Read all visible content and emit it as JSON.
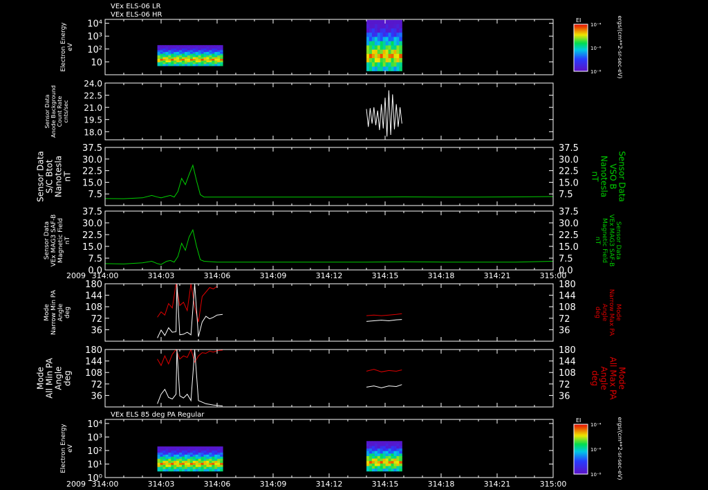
{
  "header": {
    "title1": "VEx ELS-06 LR",
    "title2": "VEx ELS-06 HR",
    "title3": "VEx ELS 85 deg PA Regular"
  },
  "colors": {
    "background": "#000000",
    "axis": "#ffffff",
    "green": "#00d000",
    "red": "#e00000",
    "white": "#ffffff"
  },
  "time_axis": {
    "year": "2009",
    "ticks": [
      "314:00",
      "314:03",
      "314:06",
      "314:09",
      "314:12",
      "314:15",
      "314:18",
      "314:21",
      "315:00"
    ]
  },
  "colorbar": {
    "title": "EI",
    "ticks": [
      "10⁻⁴",
      "10⁻⁶",
      "10⁻⁸"
    ],
    "unit": "ergs/(cm**2-sr-sec-eV)",
    "scale": "log"
  },
  "chart_data": [
    {
      "type": "heatmap",
      "id": "p1",
      "ylabel_lines": [
        "Electron Energy",
        "eV"
      ],
      "y_scale": "log",
      "ytick_labels": [
        "10⁴",
        "10³",
        "10²",
        "10"
      ],
      "ylim": [
        1,
        20000
      ],
      "x_unit": "minutes after 314:00",
      "blocks": [
        {
          "x_range": [
            2.8,
            6.3
          ],
          "y_range": [
            5,
            200
          ]
        },
        {
          "x_range": [
            14.0,
            15.9
          ],
          "y_range": [
            2,
            18000
          ]
        }
      ]
    },
    {
      "type": "line",
      "id": "p2",
      "ylabel_lines": [
        "Sensor Data",
        "Anode Background",
        "Count Rate",
        "cnts/sec"
      ],
      "yticks": [
        "24.0",
        "22.5",
        "21.0",
        "19.5",
        "18.0"
      ],
      "ylim": [
        17.0,
        24.0
      ],
      "series": [
        {
          "color": "white",
          "x": [
            14.0,
            14.1,
            14.2,
            14.3,
            14.4,
            14.5,
            14.6,
            14.7,
            14.8,
            14.9,
            15.0,
            15.1,
            15.2,
            15.3,
            15.4,
            15.5,
            15.6,
            15.7,
            15.8,
            15.9
          ],
          "y": [
            20.8,
            18.6,
            20.9,
            19.0,
            21.0,
            18.8,
            20.6,
            18.2,
            21.4,
            18.4,
            22.2,
            17.4,
            23.1,
            17.6,
            22.6,
            18.3,
            21.4,
            18.6,
            21.0,
            19.0
          ]
        }
      ]
    },
    {
      "type": "line",
      "id": "p3",
      "ylabel_lines": [
        "Sensor Data",
        "S/C Btot",
        "Nanotesla",
        "nT"
      ],
      "right_label_lines": [
        "Sensor Data",
        "VSO B",
        "Nanotesla",
        "nT"
      ],
      "yticks": [
        "37.5",
        "30.0",
        "22.5",
        "15.0",
        "7.5"
      ],
      "ylim": [
        0,
        37.5
      ],
      "series": [
        {
          "color": "green",
          "x": [
            0,
            1,
            2,
            2.5,
            2.8,
            3.0,
            3.3,
            3.5,
            3.7,
            3.9,
            4.1,
            4.3,
            4.5,
            4.7,
            4.9,
            5.1,
            5.3,
            6,
            8,
            10,
            12,
            14,
            16,
            18,
            20,
            22,
            24
          ],
          "y": [
            4.5,
            4.4,
            5.0,
            6.5,
            5.5,
            5.0,
            6.0,
            6.5,
            5.5,
            9.0,
            17.5,
            13.5,
            20.0,
            26.0,
            16.0,
            7.0,
            5.5,
            5.5,
            5.5,
            5.5,
            5.5,
            5.5,
            5.6,
            5.5,
            5.5,
            5.6,
            5.8
          ]
        }
      ]
    },
    {
      "type": "line",
      "id": "p4",
      "ylabel_lines": [
        "Sensor Data",
        "VEx MAG3 SAF-B",
        "Magnetic Field",
        "nT"
      ],
      "right_label_lines": [
        "Sensor Data",
        "VEx MAG3 SAF-B",
        "Magnetic Field",
        "nT"
      ],
      "yticks": [
        "37.5",
        "30.0",
        "22.5",
        "15.0",
        "7.5",
        "0.0"
      ],
      "ylim": [
        0,
        37.5
      ],
      "series": [
        {
          "color": "green",
          "x": [
            0,
            1,
            2,
            2.5,
            2.8,
            3.0,
            3.3,
            3.5,
            3.7,
            3.9,
            4.1,
            4.3,
            4.5,
            4.7,
            4.9,
            5.1,
            5.3,
            6,
            8,
            10,
            12,
            14,
            16,
            18,
            20,
            22,
            24
          ],
          "y": [
            4.0,
            3.8,
            4.5,
            5.5,
            4.0,
            3.5,
            5.5,
            6.0,
            5.0,
            8.5,
            17.0,
            12.5,
            21.0,
            25.5,
            15.0,
            6.5,
            5.5,
            5.0,
            5.0,
            5.0,
            5.0,
            5.0,
            5.2,
            5.0,
            5.0,
            5.0,
            5.5
          ]
        }
      ]
    },
    {
      "type": "line",
      "id": "p5",
      "ylabel_lines": [
        "Mode",
        "Narrow Min PA",
        "Angle",
        "deg"
      ],
      "right_label_lines": [
        "Mode",
        "Narrow Max PA",
        "Angle",
        "deg"
      ],
      "yticks": [
        "180",
        "144",
        "108",
        "72",
        "36"
      ],
      "ylim": [
        0,
        180
      ],
      "series": [
        {
          "name": "Narrow Max PA",
          "color": "red",
          "x": [
            2.8,
            3.0,
            3.2,
            3.4,
            3.6,
            3.8,
            4.0,
            4.2,
            4.4,
            4.6,
            4.8,
            5.0,
            5.2,
            5.4,
            5.6,
            5.8,
            6.0
          ],
          "y": [
            75,
            92,
            82,
            118,
            104,
            180,
            112,
            122,
            96,
            180,
            108,
            60,
            140,
            154,
            168,
            164,
            172
          ]
        },
        {
          "name": "Narrow Min PA",
          "color": "white",
          "x": [
            2.8,
            3.0,
            3.2,
            3.4,
            3.6,
            3.8,
            3.85,
            4.0,
            4.2,
            4.4,
            4.6,
            4.8,
            5.0,
            5.2,
            5.4,
            5.6,
            5.8,
            6.0,
            6.3
          ],
          "y": [
            10,
            35,
            18,
            42,
            28,
            30,
            180,
            20,
            22,
            28,
            20,
            180,
            14,
            60,
            78,
            70,
            75,
            82,
            84
          ]
        },
        {
          "color": "red",
          "x": [
            14.0,
            14.4,
            14.8,
            15.2,
            15.6,
            15.9
          ],
          "y": [
            80,
            82,
            80,
            82,
            84,
            86
          ]
        },
        {
          "color": "white",
          "x": [
            14.0,
            14.4,
            14.8,
            15.2,
            15.6,
            15.9
          ],
          "y": [
            62,
            64,
            66,
            64,
            67,
            68
          ]
        }
      ]
    },
    {
      "type": "line",
      "id": "p6",
      "ylabel_lines": [
        "Mode",
        "All Min PA",
        "Angle",
        "deg"
      ],
      "right_label_lines": [
        "Mode",
        "All Max PA",
        "Angle",
        "deg"
      ],
      "yticks": [
        "180",
        "144",
        "108",
        "72",
        "36"
      ],
      "ylim": [
        0,
        180
      ],
      "series": [
        {
          "name": "All Max PA",
          "color": "red",
          "x": [
            2.8,
            3.0,
            3.2,
            3.4,
            3.6,
            3.8,
            4.0,
            4.2,
            4.4,
            4.6,
            4.8,
            5.0,
            5.2,
            5.4,
            5.6,
            5.8,
            6.0,
            6.3
          ],
          "y": [
            150,
            130,
            160,
            135,
            165,
            180,
            150,
            160,
            155,
            180,
            140,
            160,
            170,
            168,
            175,
            172,
            176,
            178
          ]
        },
        {
          "name": "All Min PA",
          "color": "white",
          "x": [
            2.8,
            3.0,
            3.2,
            3.4,
            3.6,
            3.8,
            3.85,
            4.0,
            4.2,
            4.4,
            4.6,
            4.8,
            5.0,
            5.2,
            5.4,
            5.6,
            5.8,
            6.0,
            6.3
          ],
          "y": [
            10,
            40,
            55,
            30,
            25,
            40,
            180,
            35,
            28,
            40,
            20,
            180,
            20,
            15,
            10,
            8,
            6,
            5,
            3
          ]
        },
        {
          "color": "red",
          "x": [
            14.0,
            14.4,
            14.8,
            15.2,
            15.6,
            15.9
          ],
          "y": [
            112,
            118,
            110,
            114,
            112,
            116
          ]
        },
        {
          "color": "white",
          "x": [
            14.0,
            14.4,
            14.8,
            15.2,
            15.6,
            15.9
          ],
          "y": [
            62,
            66,
            60,
            66,
            64,
            70
          ]
        }
      ]
    },
    {
      "type": "heatmap",
      "id": "p7",
      "ylabel_lines": [
        "Electron Energy",
        "eV"
      ],
      "y_scale": "log",
      "ytick_labels": [
        "10⁴",
        "10³",
        "10²",
        "10¹",
        "10⁰"
      ],
      "ylim": [
        1,
        20000
      ],
      "blocks": [
        {
          "x_range": [
            2.8,
            6.3
          ],
          "y_range": [
            3,
            200
          ]
        },
        {
          "x_range": [
            14.0,
            15.9
          ],
          "y_range": [
            3,
            500
          ]
        }
      ]
    }
  ]
}
